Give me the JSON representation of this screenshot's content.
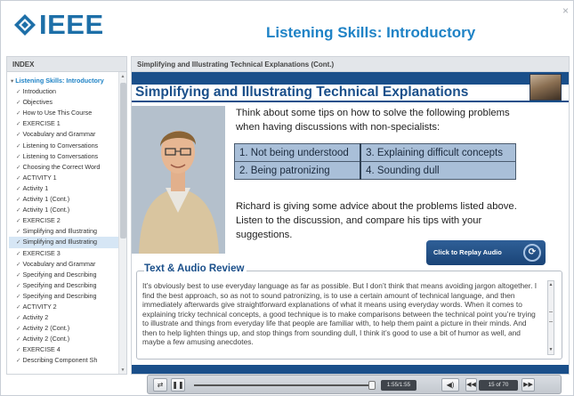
{
  "header": {
    "logo_text": "IEEE",
    "course_title": "Listening Skills: Introductory",
    "close_icon": "×"
  },
  "index": {
    "heading": "INDEX",
    "items": [
      {
        "label": "Listening Skills: Introductory",
        "type": "parent"
      },
      {
        "label": "Introduction",
        "checked": true
      },
      {
        "label": "Objectives",
        "checked": true
      },
      {
        "label": "How to Use This Course",
        "checked": true
      },
      {
        "label": "EXERCISE 1",
        "checked": true
      },
      {
        "label": "Vocabulary and Grammar",
        "checked": true
      },
      {
        "label": "Listening to Conversations",
        "checked": true
      },
      {
        "label": "Listening to Conversations",
        "checked": true
      },
      {
        "label": "Choosing the Correct Word",
        "checked": true
      },
      {
        "label": "ACTIVITY 1",
        "checked": true
      },
      {
        "label": "Activity 1",
        "checked": true
      },
      {
        "label": "Activity 1 (Cont.)",
        "checked": true
      },
      {
        "label": "Activity 1 (Cont.)",
        "checked": true
      },
      {
        "label": "EXERCISE 2",
        "checked": true
      },
      {
        "label": "Simplifying and Illustrating",
        "checked": true
      },
      {
        "label": "Simplifying and Illustrating",
        "checked": true,
        "active": true
      },
      {
        "label": "EXERCISE 3",
        "checked": true
      },
      {
        "label": "Vocabulary and Grammar",
        "checked": true
      },
      {
        "label": "Specifying and Describing",
        "checked": true
      },
      {
        "label": "Specifying and Describing",
        "checked": true
      },
      {
        "label": "Specifying and Describing",
        "checked": true
      },
      {
        "label": "ACTIVITY 2",
        "checked": true
      },
      {
        "label": "Activity 2",
        "checked": true
      },
      {
        "label": "Activity 2 (Cont.)",
        "checked": true
      },
      {
        "label": "Activity 2 (Cont.)",
        "checked": true
      },
      {
        "label": "EXERCISE 4",
        "checked": true
      },
      {
        "label": "Describing Component Sh",
        "checked": true
      }
    ]
  },
  "content": {
    "breadcrumb": "Simplifying and Illustrating Technical Explanations (Cont.)",
    "slide_title": "Simplifying and Illustrating Technical Explanations",
    "intro": "Think about some tips on how to solve the following problems when having discussions with non-specialists:",
    "tips": [
      [
        "1. Not being understood",
        "3. Explaining difficult concepts"
      ],
      [
        "2. Being patronizing",
        "4. Sounding dull"
      ]
    ],
    "richard": "Richard is giving some advice about the problems listed above. Listen to the discussion, and compare his tips with your suggestions.",
    "replay_label": "Click to Replay Audio",
    "review_title": "Text & Audio Review",
    "review_text": "It’s obviously best to use everyday language as far as possible. But I don’t think that means avoiding jargon altogether. I find the best approach, so as not to sound patronizing, is to use a certain amount of technical language, and then immediately afterwards give straightforward explanations of what it means using everyday words. When it comes to explaining tricky technical concepts, a good technique is to make comparisons between the technical point you’re trying to illustrate and things from everyday life that people are familiar with, to help them paint a picture in their minds. And then to help lighten things up, and stop things from sounding dull, I think it’s good to use a bit of humor as well, and maybe a few amusing anecdotes."
  },
  "player": {
    "time": "1:55/1:55",
    "page": "15 of 70",
    "progress": 1.0
  }
}
